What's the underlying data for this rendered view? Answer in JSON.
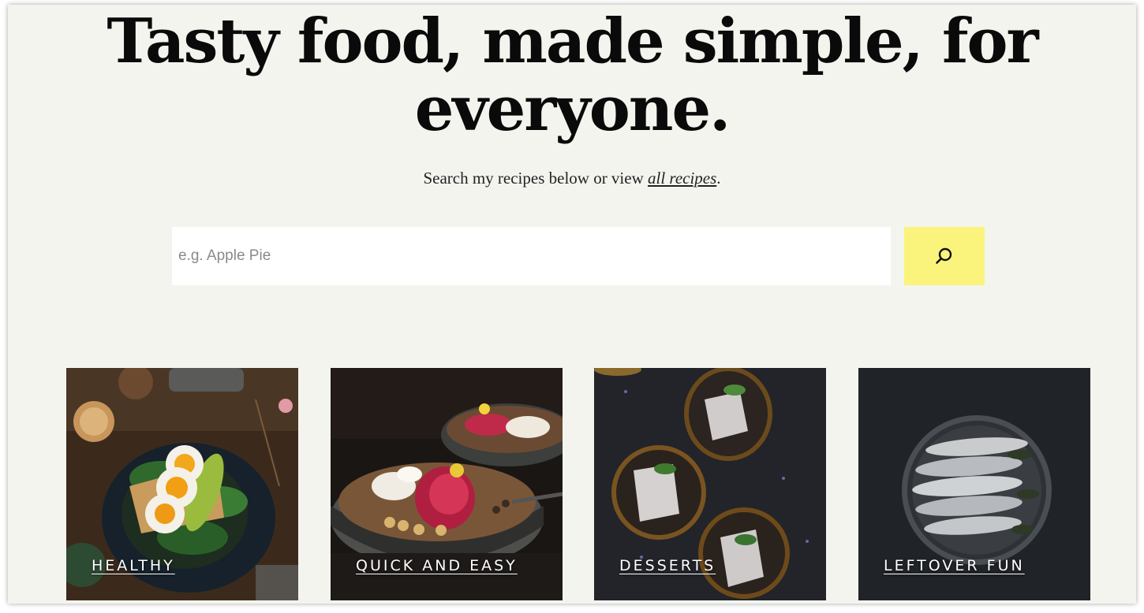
{
  "hero": {
    "headline_line1": "Tasty food, made simple, for",
    "headline_line2": "everyone.",
    "subline_prefix": "Search my recipes below or view ",
    "subline_link": "all recipes",
    "subline_suffix": "."
  },
  "search": {
    "placeholder": "e.g. Apple Pie",
    "button_icon": "search-icon",
    "button_color": "#faf47c"
  },
  "categories": [
    {
      "label": "HEALTHY"
    },
    {
      "label": "QUICK AND EASY"
    },
    {
      "label": "DESSERTS"
    },
    {
      "label": "LEFTOVER FUN"
    }
  ],
  "colors": {
    "page_background": "#f4f4ef",
    "headline": "#0a0a0a"
  }
}
